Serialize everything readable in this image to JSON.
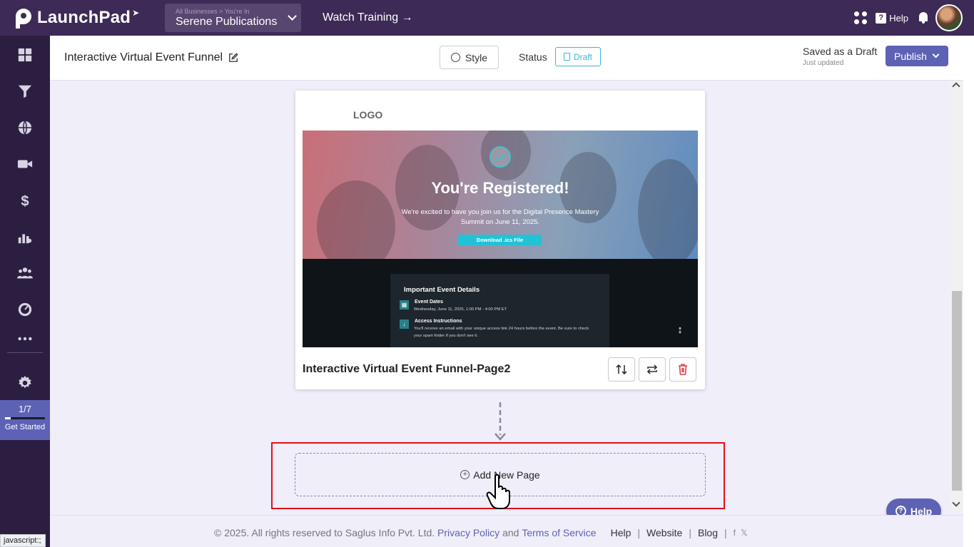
{
  "topbar": {
    "brand": "LaunchPad",
    "business_switch_label": "All Businesses > You're In",
    "business_name": "Serene Publications",
    "watch_training": "Watch Training →",
    "help": "Help"
  },
  "sidebar": {
    "items": [
      "dashboard",
      "funnels",
      "websites",
      "webinars",
      "payments",
      "analytics",
      "contacts",
      "reports",
      "more"
    ],
    "get_started": {
      "count": "1/7",
      "label": "Get Started",
      "progress": 0.14
    }
  },
  "header": {
    "funnel_title": "Interactive Virtual Event Funnel",
    "style_label": "Style",
    "status_label": "Status",
    "draft_label": "Draft",
    "saved_main": "Saved as a Draft",
    "saved_sub": "Just updated",
    "publish_label": "Publish"
  },
  "page_card": {
    "logo": "LOGO",
    "hero_title": "You're Registered!",
    "hero_text": "We're excited to have you join us for the Digital Presence Mastery Summit on June 11, 2025.",
    "hero_button": "Download .ics File",
    "details_heading": "Important Event Details",
    "details": [
      {
        "title": "Event Dates",
        "text": "Wednesday, June 11, 2025, 1:00 PM - 4:00 PM ET"
      },
      {
        "title": "Access Instructions",
        "text": "You'll receive an email with your unique access link 24 hours before the event. Be sure to check your spam folder if you don't see it."
      }
    ],
    "name": "Interactive Virtual Event Funnel-Page2"
  },
  "add_page": {
    "label": "Add New Page"
  },
  "help_fab": "Help",
  "status_bar_text": "javascript:;",
  "footer": {
    "copyright": "©  2025. All rights reserved to Saglus Info Pvt. Ltd.",
    "privacy": "Privacy Policy",
    "and": "and",
    "terms": "Terms of Service",
    "help": "Help",
    "website": "Website",
    "blog": "Blog",
    "sep": "|"
  },
  "colors": {
    "topbar": "#3d2a57",
    "sidebar": "#2b1e41",
    "accent": "#5d62b5",
    "draft": "#3cb4d8",
    "highlight": "#e0101a",
    "delete": "#e0404a"
  }
}
